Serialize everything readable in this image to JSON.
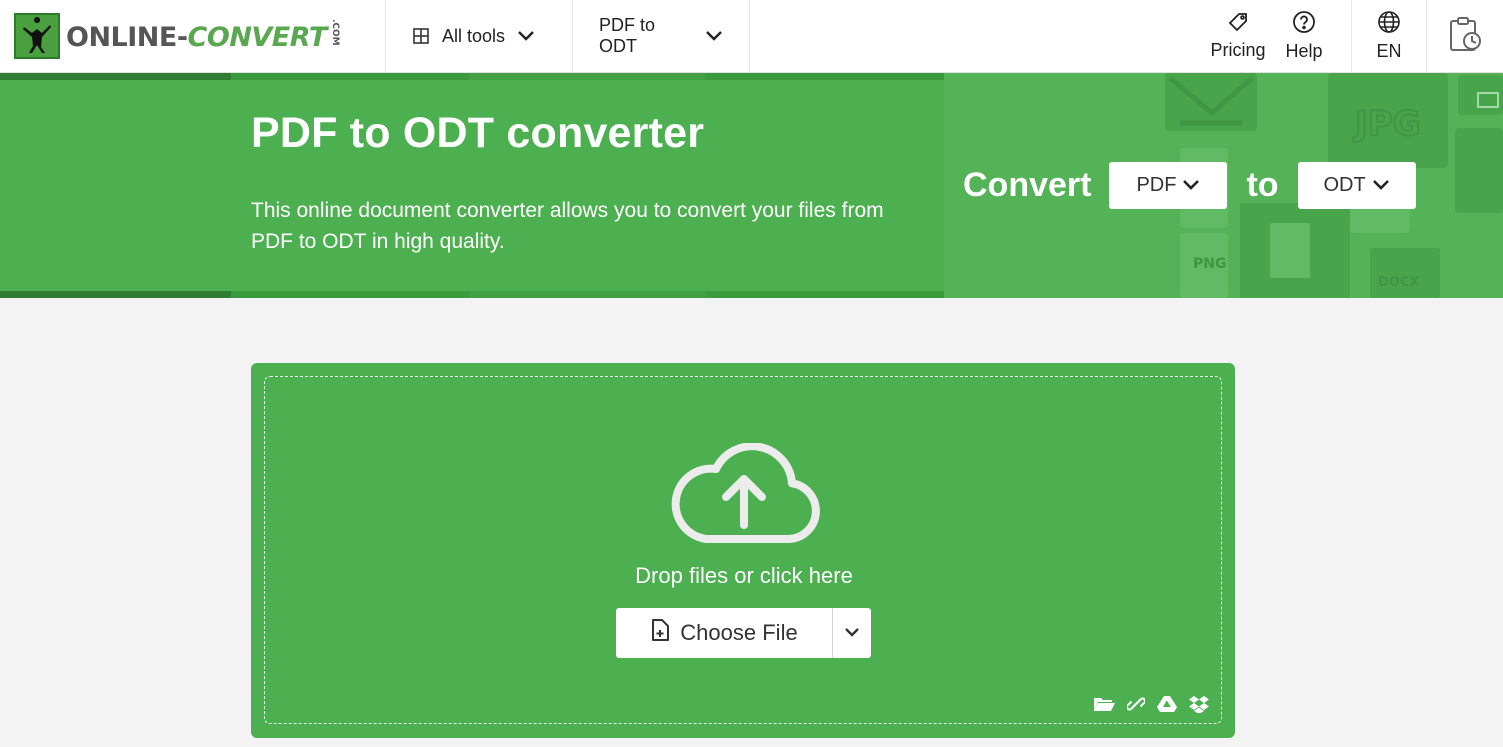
{
  "header": {
    "logo_text_main": "ONLINE-",
    "logo_text_accent": "CONVERT",
    "logo_text_suffix": ".COM",
    "all_tools_label": "All tools",
    "conversion_menu_label": "PDF to ODT",
    "pricing_label": "Pricing",
    "help_label": "Help",
    "language_label": "EN"
  },
  "hero": {
    "title": "PDF to ODT converter",
    "description": "This online document converter allows you to convert your files from PDF to ODT in high quality.",
    "convert_label": "Convert",
    "from_format": "PDF",
    "to_label": "to",
    "to_format": "ODT",
    "decor_labels": [
      "JPG",
      "PNG",
      "DOCX"
    ]
  },
  "upload": {
    "drop_text": "Drop files or click here",
    "choose_file_label": "Choose File"
  },
  "colors": {
    "brand_green": "#4caf50",
    "dark_green": "#2e7d32",
    "white": "#ffffff"
  },
  "icons": [
    "grid-icon",
    "chevron-down-icon",
    "tag-icon",
    "help-circle-icon",
    "globe-icon",
    "clipboard-history-icon",
    "cloud-upload-icon",
    "file-plus-icon",
    "folder-icon",
    "link-icon",
    "google-drive-icon",
    "dropbox-icon"
  ]
}
